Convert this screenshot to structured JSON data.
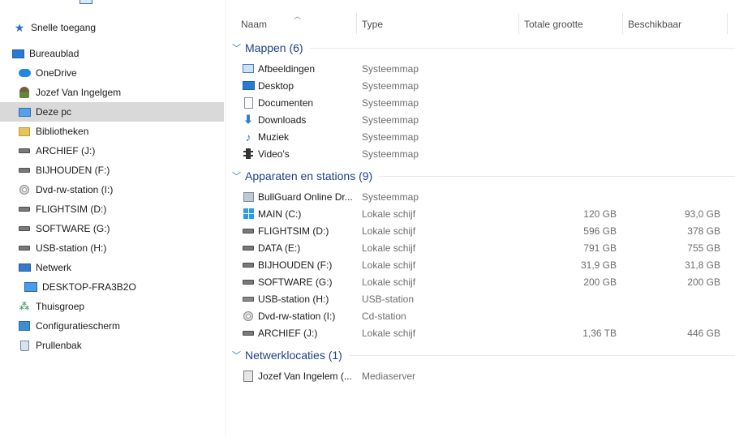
{
  "breadcrumb": {
    "current": "Deze pc"
  },
  "sidebar": {
    "items": [
      {
        "label": "Snelle toegang",
        "icon": "star-icon"
      },
      {
        "label": "Bureaublad",
        "icon": "desktop-icon"
      },
      {
        "label": "OneDrive",
        "icon": "onedrive-cloud-icon"
      },
      {
        "label": "Jozef Van Ingelgem",
        "icon": "user-icon"
      },
      {
        "label": "Deze pc",
        "icon": "this-pc-icon"
      },
      {
        "label": "Bibliotheken",
        "icon": "libraries-icon"
      },
      {
        "label": "ARCHIEF (J:)",
        "icon": "drive-icon"
      },
      {
        "label": "BIJHOUDEN (F:)",
        "icon": "drive-icon"
      },
      {
        "label": "Dvd-rw-station (I:)",
        "icon": "dvd-drive-icon"
      },
      {
        "label": "FLIGHTSIM (D:)",
        "icon": "drive-icon"
      },
      {
        "label": "SOFTWARE (G:)",
        "icon": "drive-icon"
      },
      {
        "label": "USB-station (H:)",
        "icon": "usb-drive-icon"
      },
      {
        "label": "Netwerk",
        "icon": "network-icon"
      },
      {
        "label": "DESKTOP-FRA3B2O",
        "icon": "computer-icon"
      },
      {
        "label": "Thuisgroep",
        "icon": "homegroup-icon"
      },
      {
        "label": "Configuratiescherm",
        "icon": "control-panel-icon"
      },
      {
        "label": "Prullenbak",
        "icon": "recycle-bin-icon"
      }
    ]
  },
  "columns": {
    "name": "Naam",
    "type": "Type",
    "total": "Totale grootte",
    "available": "Beschikbaar"
  },
  "groups": [
    {
      "title": "Mappen (6)",
      "rows": [
        {
          "name": "Afbeeldingen",
          "type": "Systeemmap",
          "total": "",
          "available": "",
          "icon": "pictures-icon"
        },
        {
          "name": "Desktop",
          "type": "Systeemmap",
          "total": "",
          "available": "",
          "icon": "desktop-icon"
        },
        {
          "name": "Documenten",
          "type": "Systeemmap",
          "total": "",
          "available": "",
          "icon": "documents-icon"
        },
        {
          "name": "Downloads",
          "type": "Systeemmap",
          "total": "",
          "available": "",
          "icon": "downloads-icon"
        },
        {
          "name": "Muziek",
          "type": "Systeemmap",
          "total": "",
          "available": "",
          "icon": "music-icon"
        },
        {
          "name": "Video's",
          "type": "Systeemmap",
          "total": "",
          "available": "",
          "icon": "videos-icon"
        }
      ]
    },
    {
      "title": "Apparaten en stations (9)",
      "rows": [
        {
          "name": "BullGuard Online Dr...",
          "type": "Systeemmap",
          "total": "",
          "available": "",
          "icon": "bullguard-icon"
        },
        {
          "name": "MAIN (C:)",
          "type": "Lokale schijf",
          "total": "120 GB",
          "available": "93,0 GB",
          "icon": "windows-drive-icon"
        },
        {
          "name": "FLIGHTSIM (D:)",
          "type": "Lokale schijf",
          "total": "596 GB",
          "available": "378 GB",
          "icon": "drive-icon"
        },
        {
          "name": "DATA (E:)",
          "type": "Lokale schijf",
          "total": "791 GB",
          "available": "755 GB",
          "icon": "drive-icon"
        },
        {
          "name": "BIJHOUDEN (F:)",
          "type": "Lokale schijf",
          "total": "31,9 GB",
          "available": "31,8 GB",
          "icon": "drive-icon"
        },
        {
          "name": "SOFTWARE (G:)",
          "type": "Lokale schijf",
          "total": "200 GB",
          "available": "200 GB",
          "icon": "drive-icon"
        },
        {
          "name": "USB-station (H:)",
          "type": "USB-station",
          "total": "",
          "available": "",
          "icon": "usb-drive-icon"
        },
        {
          "name": "Dvd-rw-station (I:)",
          "type": "Cd-station",
          "total": "",
          "available": "",
          "icon": "dvd-drive-icon"
        },
        {
          "name": "ARCHIEF (J:)",
          "type": "Lokale schijf",
          "total": "1,36 TB",
          "available": "446 GB",
          "icon": "drive-icon"
        }
      ]
    },
    {
      "title": "Netwerklocaties (1)",
      "rows": [
        {
          "name": "Jozef Van Ingelem (...",
          "type": "Mediaserver",
          "total": "",
          "available": "",
          "icon": "media-server-icon"
        }
      ]
    }
  ]
}
